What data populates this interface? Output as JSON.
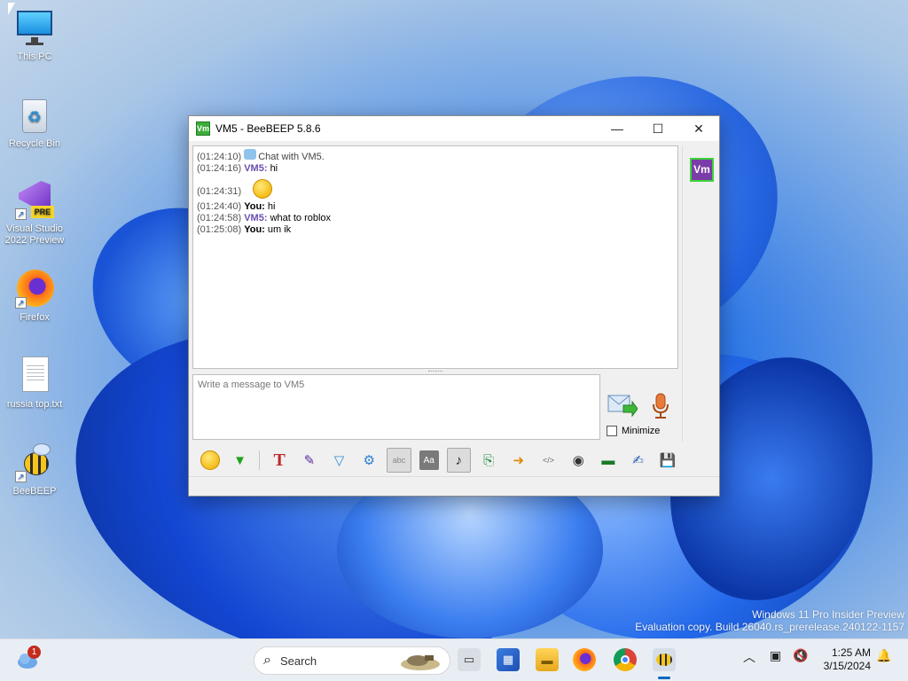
{
  "desktop": {
    "icons": [
      {
        "label": "This PC",
        "icon": "monitor-icon"
      },
      {
        "label": "Recycle Bin",
        "icon": "recycle-bin-icon"
      },
      {
        "label": "Visual Studio 2022 Preview",
        "icon": "visual-studio-icon",
        "badge": "PRE"
      },
      {
        "label": "Firefox",
        "icon": "firefox-icon"
      },
      {
        "label": "russia top.txt",
        "icon": "text-file-icon"
      },
      {
        "label": "BeeBEEP",
        "icon": "bee-icon"
      }
    ],
    "watermark": {
      "line1": "Windows 11 Pro Insider Preview",
      "line2": "Evaluation copy. Build 26040.rs_prerelease.240122-1157"
    }
  },
  "window": {
    "app_icon_text": "Vm",
    "title": "VM5 - BeeBEEP 5.8.6",
    "controls": {
      "minimize": "—",
      "maximize": "☐",
      "close": "✕"
    },
    "chat": {
      "messages": [
        {
          "time": "(01:24:10)",
          "sender": "",
          "text": "Chat with VM5."
        },
        {
          "time": "(01:24:16)",
          "sender": "VM5:",
          "text": "hi"
        },
        {
          "time": "(01:24:31)",
          "sender": "",
          "text": ""
        },
        {
          "time": "(01:24:40)",
          "sender": "You:",
          "text": "hi"
        },
        {
          "time": "(01:24:58)",
          "sender": "VM5:",
          "text": "what to roblox"
        },
        {
          "time": "(01:25:08)",
          "sender": "You:",
          "text": "um ik"
        }
      ]
    },
    "input": {
      "placeholder": "Write a message to VM5"
    },
    "minimize_label": "Minimize",
    "sidebar_avatar": "Vm",
    "toolbar": [
      {
        "name": "emoticon-button",
        "icon": "☺"
      },
      {
        "name": "collapse-button",
        "icon": "▼"
      },
      {
        "name": "font-button",
        "icon": "T"
      },
      {
        "name": "color-button",
        "icon": "✎"
      },
      {
        "name": "filter-button",
        "icon": "▽"
      },
      {
        "name": "settings-button",
        "icon": "⚙"
      },
      {
        "name": "spellcheck-button",
        "icon": "abc"
      },
      {
        "name": "text-style-button",
        "icon": "Aa"
      },
      {
        "name": "sound-button",
        "icon": "♪"
      },
      {
        "name": "save-chat-button",
        "icon": "⎘"
      },
      {
        "name": "send-file-button",
        "icon": "➜"
      },
      {
        "name": "html-button",
        "icon": "</>"
      },
      {
        "name": "screenshot-button",
        "icon": "◉"
      },
      {
        "name": "terminal-button",
        "icon": "▬"
      },
      {
        "name": "note-button",
        "icon": "✍"
      },
      {
        "name": "save-button",
        "icon": "💾"
      }
    ]
  },
  "taskbar": {
    "notification_badge": "1",
    "search_label": "Search",
    "clock": {
      "time": "1:25 AM",
      "date": "3/15/2024"
    }
  }
}
